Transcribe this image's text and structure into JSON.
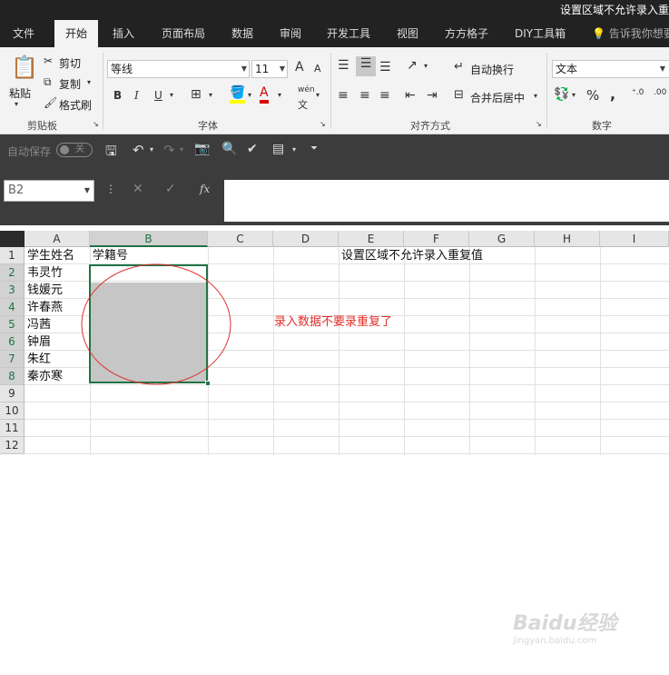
{
  "window": {
    "title": "设置区域不允许录入重"
  },
  "tabs": [
    "文件",
    "开始",
    "插入",
    "页面布局",
    "数据",
    "审阅",
    "开发工具",
    "视图",
    "方方格子",
    "DIY工具箱"
  ],
  "tell_me": "告诉我你想要",
  "ribbon": {
    "clipboard": {
      "label": "剪贴板",
      "paste": "粘贴",
      "cut": "剪切",
      "copy": "复制",
      "format_painter": "格式刷"
    },
    "font": {
      "label": "字体",
      "font_name": "等线",
      "font_size": "11",
      "bold": "B",
      "italic": "I",
      "underline": "U",
      "wen": "wén",
      "grow": "A",
      "shrink": "A"
    },
    "alignment": {
      "label": "对齐方式",
      "wrap": "自动换行",
      "merge": "合并后居中"
    },
    "number": {
      "label": "数字",
      "format": "文本",
      "percent": "%",
      "comma": ","
    }
  },
  "qat": {
    "autosave": "自动保存",
    "toggle": "关"
  },
  "formula_bar": {
    "name_box": "B2",
    "fx": "fx"
  },
  "columns": [
    "A",
    "B",
    "C",
    "D",
    "E",
    "F",
    "G",
    "H",
    "I"
  ],
  "rows": [
    "1",
    "2",
    "3",
    "4",
    "5",
    "6",
    "7",
    "8",
    "9",
    "10",
    "11",
    "12"
  ],
  "cells": {
    "A1": "学生姓名",
    "B1": "学籍号",
    "E1": "设置区域不允许录入重复值",
    "A2": "韦灵竹",
    "A3": "钱媛元",
    "A4": "许春燕",
    "A5": "冯茜",
    "A6": "钟眉",
    "A7": "朱红",
    "A8": "秦亦寒"
  },
  "annotation": {
    "text": "录入数据不要录重复了",
    "color": "#e0302a"
  },
  "watermark": {
    "text": "Baidu经验",
    "sub": "jingyan.baidu.com"
  },
  "colors": {
    "accent": "#217346",
    "dark_bar": "#222222"
  }
}
